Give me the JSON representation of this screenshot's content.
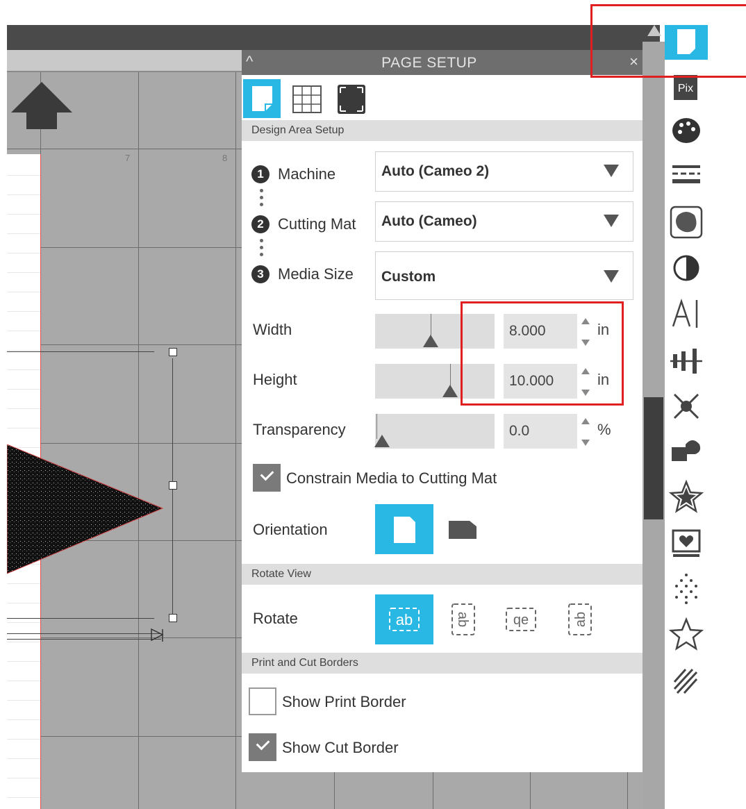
{
  "panel": {
    "title": "PAGE SETUP",
    "caret": "^",
    "close": "×"
  },
  "ruler": {
    "n7": "7",
    "n8": "8"
  },
  "sections": {
    "design_area": "Design Area Setup",
    "rotate_view": "Rotate View",
    "print_cut": "Print and Cut Borders"
  },
  "steps": {
    "s1": "1",
    "s2": "2",
    "s3": "3"
  },
  "machine": {
    "label": "Machine",
    "value": "Auto (Cameo 2)"
  },
  "cutting_mat": {
    "label": "Cutting Mat",
    "value": "Auto (Cameo)"
  },
  "media_size": {
    "label": "Media Size",
    "value": "Custom"
  },
  "width": {
    "label": "Width",
    "value": "8.000",
    "unit": "in"
  },
  "height": {
    "label": "Height",
    "value": "10.000",
    "unit": "in"
  },
  "transparency": {
    "label": "Transparency",
    "value": "0.0",
    "unit": "%"
  },
  "constrain": {
    "label": "Constrain Media to Cutting Mat",
    "checked": true
  },
  "orientation": {
    "label": "Orientation",
    "selected": "portrait"
  },
  "rotate": {
    "label": "Rotate",
    "options": [
      "ab",
      "ab",
      "qe",
      "ab"
    ],
    "selected_index": 0
  },
  "show_print_border": {
    "label": "Show Print Border",
    "checked": false
  },
  "show_cut_border": {
    "label": "Show Cut Border",
    "checked": true
  },
  "sidebar": {
    "pix_label": "Pix"
  },
  "colors": {
    "accent": "#29b7e4",
    "highlight": "#e02020",
    "header": "#6e6e6e"
  }
}
